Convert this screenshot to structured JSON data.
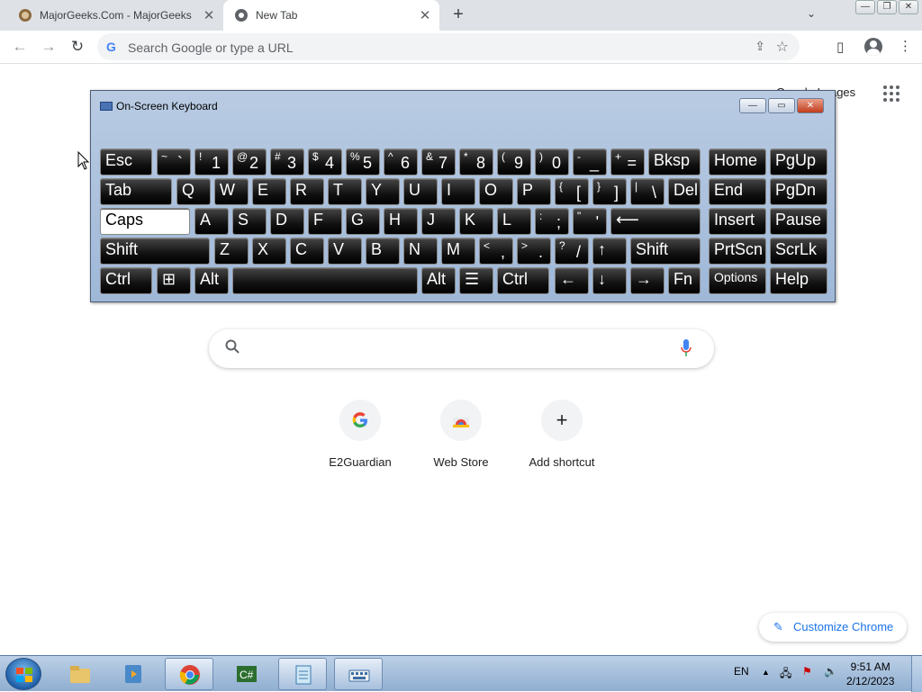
{
  "browser": {
    "tabs": [
      {
        "title": "MajorGeeks.Com - MajorGeeks",
        "active": false
      },
      {
        "title": "New Tab",
        "active": true
      }
    ],
    "new_tab": "+",
    "omnibox_placeholder": "Search Google or type a URL",
    "top_right_link": "Google Images"
  },
  "osk": {
    "title": "On-Screen Keyboard",
    "keys": [
      {
        "m": "Esc"
      },
      {
        "s": "~",
        "l": "`"
      },
      {
        "s": "!",
        "l": "1"
      },
      {
        "s": "@",
        "l": "2"
      },
      {
        "s": "#",
        "l": "3"
      },
      {
        "s": "$",
        "l": "4"
      },
      {
        "s": "%",
        "l": "5"
      },
      {
        "s": "^",
        "l": "6"
      },
      {
        "s": "&",
        "l": "7"
      },
      {
        "s": "*",
        "l": "8"
      },
      {
        "s": "(",
        "l": "9"
      },
      {
        "s": ")",
        "l": "0"
      },
      {
        "s": "-",
        "l": "_"
      },
      {
        "s": "+",
        "l": "="
      },
      {
        "m": "Bksp"
      },
      {
        "m": "Home"
      },
      {
        "m": "PgUp"
      },
      {
        "m": "Tab"
      },
      {
        "m": "Q"
      },
      {
        "m": "W"
      },
      {
        "m": "E"
      },
      {
        "m": "R"
      },
      {
        "m": "T"
      },
      {
        "m": "Y"
      },
      {
        "m": "U"
      },
      {
        "m": "I"
      },
      {
        "m": "O"
      },
      {
        "m": "P"
      },
      {
        "s": "{",
        "l": "["
      },
      {
        "s": "}",
        "l": "]"
      },
      {
        "s": "|",
        "l": "\\"
      },
      {
        "m": "Del"
      },
      {
        "m": "End"
      },
      {
        "m": "PgDn"
      },
      {
        "m": "Caps"
      },
      {
        "m": "A"
      },
      {
        "m": "S"
      },
      {
        "m": "D"
      },
      {
        "m": "F"
      },
      {
        "m": "G"
      },
      {
        "m": "H"
      },
      {
        "m": "J"
      },
      {
        "m": "K"
      },
      {
        "m": "L"
      },
      {
        "s": ":",
        "l": ";"
      },
      {
        "s": "\"",
        "l": "'"
      },
      {
        "m": "⟵"
      },
      {
        "m": "Insert"
      },
      {
        "m": "Pause"
      },
      {
        "m": "Shift"
      },
      {
        "m": "Z"
      },
      {
        "m": "X"
      },
      {
        "m": "C"
      },
      {
        "m": "V"
      },
      {
        "m": "B"
      },
      {
        "m": "N"
      },
      {
        "m": "M"
      },
      {
        "s": "<",
        "l": ","
      },
      {
        "s": ">",
        "l": "."
      },
      {
        "s": "?",
        "l": "/"
      },
      {
        "m": "↑"
      },
      {
        "m": "Shift"
      },
      {
        "m": "PrtScn"
      },
      {
        "m": "ScrLk"
      },
      {
        "m": "Ctrl"
      },
      {
        "m": "⊞"
      },
      {
        "m": "Alt"
      },
      {
        "m": ""
      },
      {
        "m": "Alt"
      },
      {
        "m": "☰"
      },
      {
        "m": "Ctrl"
      },
      {
        "m": "←"
      },
      {
        "m": "↓"
      },
      {
        "m": "→"
      },
      {
        "m": "Fn"
      },
      {
        "m": "Options"
      },
      {
        "m": "Help"
      }
    ]
  },
  "shortcuts": [
    {
      "label": "E2Guardian",
      "icon": "google-icon"
    },
    {
      "label": "Web Store",
      "icon": "web-store-icon"
    },
    {
      "label": "Add shortcut",
      "icon": "plus-icon"
    }
  ],
  "customize_label": "Customize Chrome",
  "taskbar": {
    "language": "EN",
    "time": "9:51 AM",
    "date": "2/12/2023"
  },
  "colors": {
    "accent": "#1a73e8",
    "tabstrip": "#dee1e6"
  }
}
